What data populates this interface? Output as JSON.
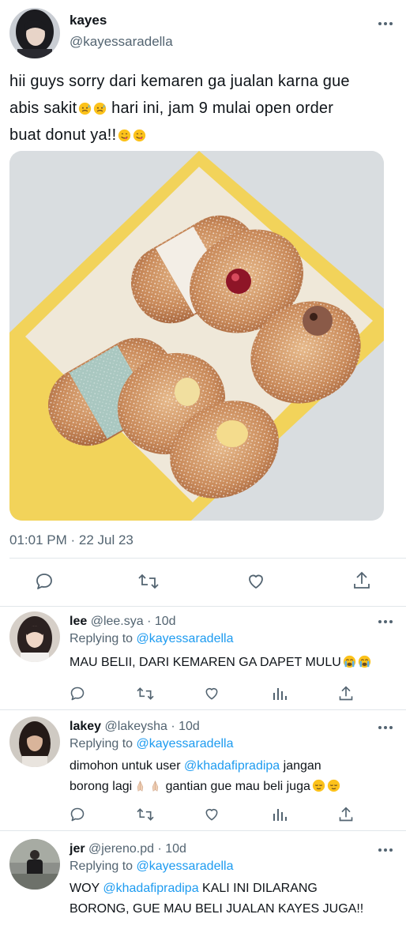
{
  "tweet": {
    "author_name": "kayes",
    "author_handle": "@kayessaradella",
    "text_line1": "hii guys sorry dari kemaren ga jualan karna gue",
    "text_line2a": "abis sakit",
    "text_line2b": " hari ini, jam 9 mulai open order",
    "text_line3": "buat donut ya!!",
    "timestamp": "01:01 PM · 22 Jul 23",
    "icons": [
      "reply-icon",
      "retweet-icon",
      "like-icon",
      "share-icon"
    ]
  },
  "replies": [
    {
      "name": "lee",
      "meta": "@lee.sya · 10d",
      "replying_prefix": "Replying to ",
      "replying_to": "@kayessaradella",
      "text_line1": "MAU BELII, DARI KEMAREN GA DAPET MULU"
    },
    {
      "name": "lakey",
      "meta": "@lakeysha · 10d",
      "replying_prefix": "Replying to ",
      "replying_to": "@kayessaradella",
      "text_line1_prefix": "dimohon untuk user ",
      "text_line1_mention": "@khadafipradipa",
      "text_line1_suffix": " jangan",
      "text_line2a": "borong lagi",
      "text_line2b": " gantian gue mau beli juga"
    },
    {
      "name": "jer",
      "meta": "@jereno.pd · 10d",
      "replying_prefix": "Replying to ",
      "replying_to": "@kayessaradella",
      "text_line1_prefix": "WOY ",
      "text_line1_mention": "@khadafipradipa",
      "text_line1_suffix": " KALI INI DILARANG",
      "text_line2": "BORONG, GUE MAU BELI JUALAN KAYES JUGA!!"
    }
  ],
  "colors": {
    "text": "#0f1419",
    "secondary": "#536471",
    "link": "#1d9bf0",
    "divider": "#e1e6ea",
    "box_yellow": "#f2d35a"
  }
}
